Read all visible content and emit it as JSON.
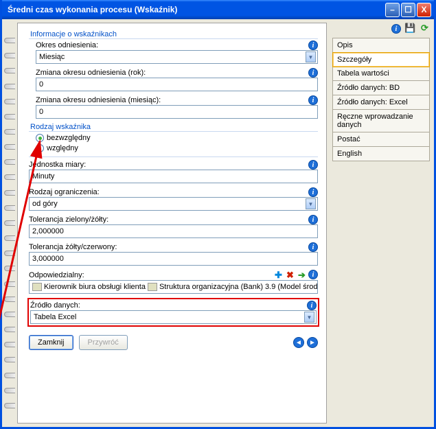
{
  "window": {
    "title": "Średni czas wykonania procesu (Wskaźnik)"
  },
  "toolbar": {},
  "right_tabs": [
    "Opis",
    "Szczegóły",
    "Tabela wartości",
    "Źródło danych: BD",
    "Źródło danych: Excel",
    "Ręczne wprowadzanie danych",
    "Postać",
    "English"
  ],
  "right_active_index": 1,
  "section_info": {
    "label": "Informacje o wskaźnikach"
  },
  "fields": {
    "ref_period": {
      "label": "Okres odniesienia:",
      "value": "Miesiąc"
    },
    "offset_year": {
      "label": "Zmiana okresu odniesienia (rok):",
      "value": "0"
    },
    "offset_month": {
      "label": "Zmiana okresu odniesienia (miesiąc):",
      "value": "0"
    }
  },
  "section_type": {
    "label": "Rodzaj wskaźnika"
  },
  "radios": {
    "absolute": "bezwzględny",
    "relative": "względny"
  },
  "unit": {
    "label": "Jednostka miary:",
    "value": "Minuty"
  },
  "constraint": {
    "label": "Rodzaj ograniczenia:",
    "value": "od góry"
  },
  "tolerance_gy": {
    "label": "Tolerancja zielony/żółty:",
    "value": "2,000000"
  },
  "tolerance_yr": {
    "label": "Tolerancja żółty/czerwony:",
    "value": "3,000000"
  },
  "responsible": {
    "label": "Odpowiedzialny:",
    "value_part1": "Kierownik biura obsługi klienta",
    "value_part2": "Struktura organizacyjna (Bank) 3.9 (Model środ"
  },
  "data_source": {
    "label": "Źródło danych:",
    "value": "Tabela Excel"
  },
  "buttons": {
    "close": "Zamknij",
    "restore": "Przywróć"
  }
}
